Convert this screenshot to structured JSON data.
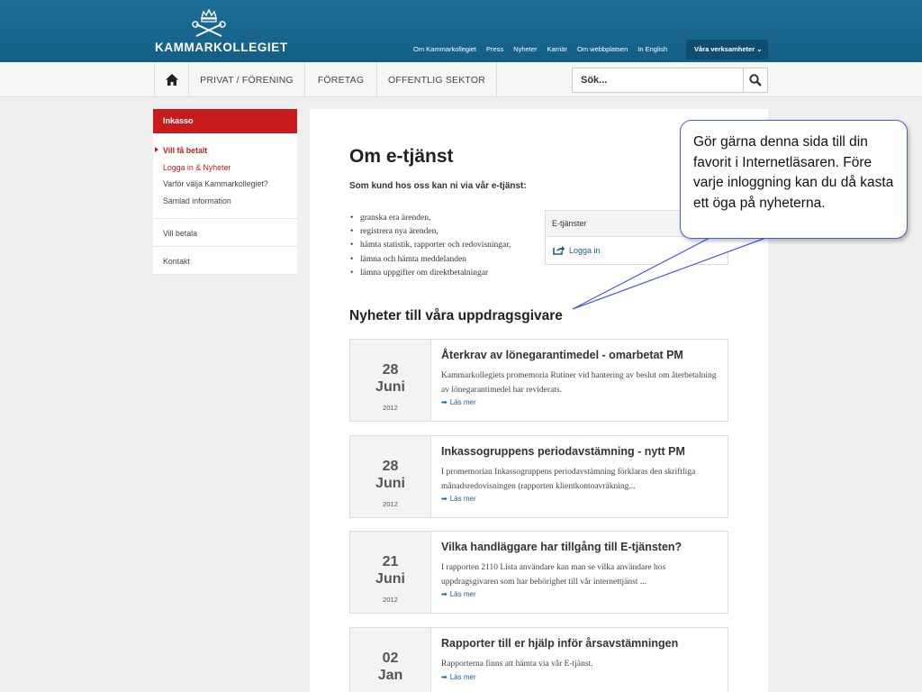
{
  "header": {
    "logo_text": "KAMMARKOLLEGIET",
    "top_links": [
      "Om Kammarkollegiet",
      "Press",
      "Nyheter",
      "Karriär",
      "Om webbplatsen",
      "In English"
    ],
    "verksamheter_label": "Våra verksamheter",
    "colors": {
      "bar": "#1a6a93",
      "accent": "#c81b1b"
    }
  },
  "nav": {
    "home_icon": "home-icon",
    "items": [
      "PRIVAT / FÖRENING",
      "FÖRETAG",
      "OFFENTLIG SEKTOR"
    ],
    "search_placeholder": "Sök...",
    "search_icon": "magnifier-icon"
  },
  "sidebar": {
    "heading": "Inkasso",
    "sub_items": [
      "Vill få betalt",
      "Logga in & Nyheter",
      "Varför välja Kammarkollegiet?",
      "Samlad information"
    ],
    "links": [
      "Vill betala",
      "Kontakt"
    ]
  },
  "main": {
    "title": "Om e-tjänst",
    "intro": "Som kund hos oss kan ni via vår e-tjänst:",
    "bullets": [
      "granska era ärenden,",
      "registrera nya ärenden,",
      "hämta statistik, rapporter och redovisningar,",
      "lämna och hämta meddelanden",
      "lämna uppgifter om direktbetalningar"
    ],
    "etjanster_heading": "E-tjänster",
    "login_label": "Logga in",
    "news_heading": "Nyheter till våra uppdragsgivare",
    "read_more": "Läs mer",
    "news": [
      {
        "day": "28",
        "month": "Juni",
        "year": "2012",
        "title": "Återkrav av lönegarantimedel - omarbetat PM",
        "text": "Kammarkollegiets promemoria Rutiner vid hantering av beslut om återbetalning av lönegarantimedel har reviderats."
      },
      {
        "day": "28",
        "month": "Juni",
        "year": "2012",
        "title": "Inkassogruppens periodavstämning - nytt PM",
        "text": "I promemorian Inkassogruppens periodavstämning förklaras den skriftliga månadsredovisningen (rapporten klientkontoavräkning..."
      },
      {
        "day": "21",
        "month": "Juni",
        "year": "2012",
        "title": "Vilka handläggare har tillgång till E-tjänsten?",
        "text": "I rapporten 2110 Lista användare kan man se vilka användare hos uppdragsgivaren som har behörighet till vår internettjänst ..."
      },
      {
        "day": "02",
        "month": "Jan",
        "year": "",
        "title": "Rapporter till er hjälp inför årsavstämningen",
        "text": "Rapporterna finns att hämta via vår E-tjänst."
      }
    ]
  },
  "callout": {
    "text": "Gör gärna denna sida till din favorit i Internetläsaren. Före varje inloggning kan du då kasta ett öga på nyheterna."
  }
}
